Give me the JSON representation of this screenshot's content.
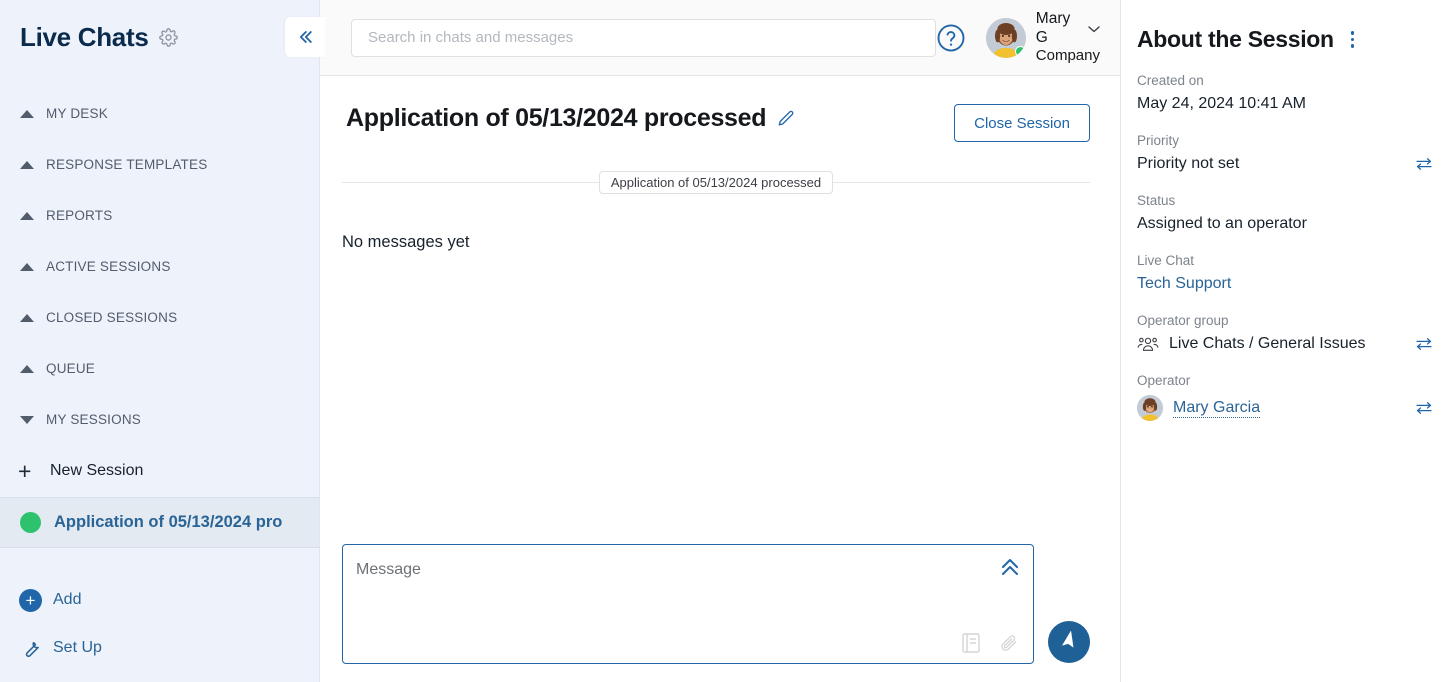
{
  "sidebar": {
    "title": "Live Chats",
    "gear_icon": "gear-icon",
    "collapse_icon": "«",
    "nav_items": [
      {
        "label": "MY DESK",
        "state": "collapsed"
      },
      {
        "label": "RESPONSE TEMPLATES",
        "state": "collapsed"
      },
      {
        "label": "REPORTS",
        "state": "collapsed"
      },
      {
        "label": "ACTIVE SESSIONS",
        "state": "collapsed"
      },
      {
        "label": "CLOSED SESSIONS",
        "state": "collapsed"
      },
      {
        "label": "QUEUE",
        "state": "collapsed"
      },
      {
        "label": "MY SESSIONS",
        "state": "expanded"
      }
    ],
    "new_session": {
      "label": "New Session",
      "icon": "plus-icon"
    },
    "session": {
      "label": "Application of 05/13/2024 pro",
      "status_color": "#2fc26e",
      "selected": true
    },
    "actions": [
      {
        "label": "Add",
        "icon": "circle-plus-icon"
      },
      {
        "label": "Set Up",
        "icon": "wrench-icon"
      }
    ]
  },
  "topbar": {
    "search": {
      "placeholder": "Search in chats and messages",
      "value": ""
    },
    "help_icon": "question-circle-icon",
    "user": {
      "name": "Mary G",
      "company": "Company",
      "online": true,
      "avatar": "user-avatar",
      "chevron": "chevron-down-icon"
    }
  },
  "chat": {
    "title": "Application of 05/13/2024 processed",
    "edit_icon": "pencil-icon",
    "close_session_label": "Close Session",
    "date_separator": "Application of 05/13/2024 processed",
    "empty_text": "No messages yet",
    "composer": {
      "placeholder": "Message",
      "value": "",
      "expand_icon": "chevron-double-up-icon",
      "template_icon": "template-book-icon",
      "attach_icon": "paperclip-icon",
      "send_icon": "send-paper-plane-icon"
    }
  },
  "right_panel": {
    "title": "About the Session",
    "menu_icon": "kebab-menu-icon",
    "fields": [
      {
        "label": "Created on",
        "value": "May 24, 2024 10:41 AM",
        "kind": "text",
        "swap": false
      },
      {
        "label": "Priority",
        "value": "Priority not set",
        "kind": "text",
        "swap": true
      },
      {
        "label": "Status",
        "value": "Assigned to an operator",
        "kind": "text",
        "swap": false
      },
      {
        "label": "Live Chat",
        "value": "Tech Support",
        "kind": "link",
        "swap": false
      },
      {
        "label": "Operator group",
        "value": "Live Chats / General Issues",
        "kind": "group",
        "swap": true
      },
      {
        "label": "Operator",
        "value": "Mary Garcia",
        "kind": "person",
        "swap": true
      }
    ]
  },
  "colors": {
    "accent": "#2066a8",
    "link": "#2a6496",
    "sidebar_bg": "#eef3fb",
    "online_green": "#2fc26e",
    "topbar_bg": "#fafafa"
  }
}
